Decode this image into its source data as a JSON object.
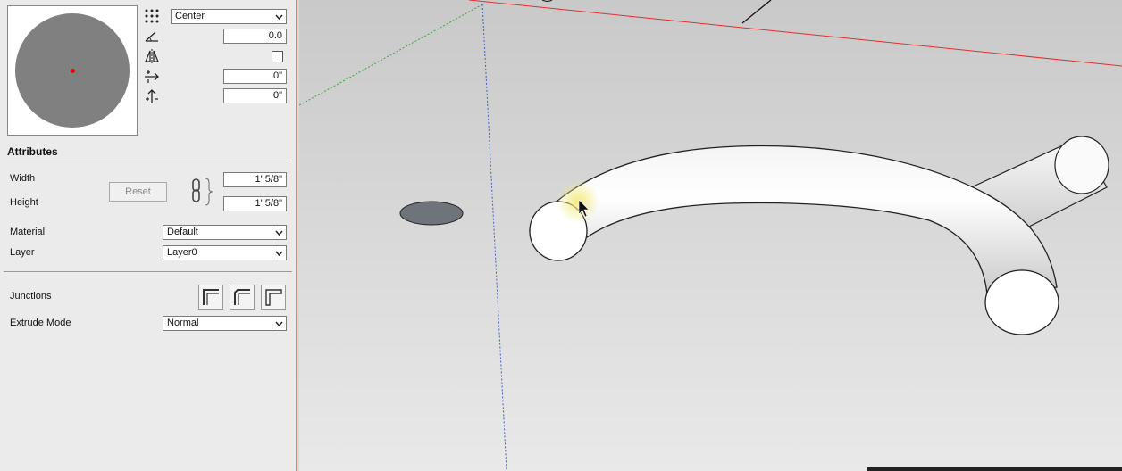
{
  "placement": {
    "justification": "Center",
    "rotation": "0.0",
    "horizontal_offset": "0\"",
    "vertical_offset": "0\""
  },
  "attributes": {
    "title": "Attributes",
    "width_label": "Width",
    "height_label": "Height",
    "width_value": "1' 5/8\"",
    "height_value": "1' 5/8\"",
    "reset_label": "Reset",
    "material_label": "Material",
    "material_value": "Default",
    "layer_label": "Layer",
    "layer_value": "Layer0"
  },
  "junctions": {
    "label": "Junctions"
  },
  "extrude": {
    "label": "Extrude Mode",
    "value": "Normal"
  },
  "colors": {
    "panel_bg": "#ebebeb",
    "profile_fill": "#808080",
    "origin_dot": "#e00000",
    "red_axis": "#e03030",
    "blue_axis": "#4060c0",
    "green_axis": "#40a040"
  }
}
